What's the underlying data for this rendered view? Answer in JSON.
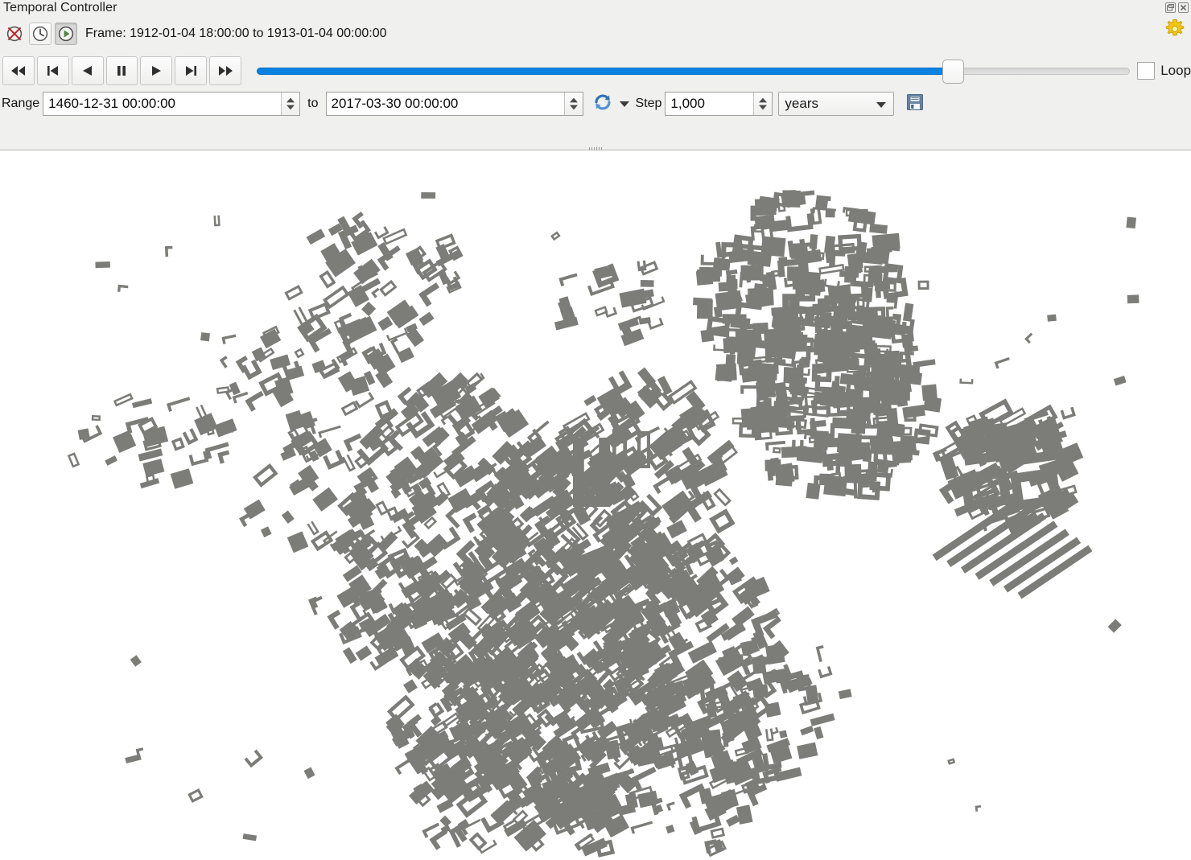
{
  "panel": {
    "title": "Temporal Controller",
    "dock_buttons": [
      {
        "name": "float-panel-icon",
        "label": "float"
      },
      {
        "name": "close-panel-icon",
        "label": "close"
      }
    ],
    "settings_icon": "gear-icon"
  },
  "modes": {
    "frame_label": "Frame: 1912-01-04 18:00:00 to 1913-01-04 00:00:00",
    "buttons": [
      {
        "name": "navigation-off-button",
        "icon": "circle-cross-icon",
        "label": "Turn off temporal navigation",
        "checked": false
      },
      {
        "name": "fixed-range-button",
        "icon": "clock-icon",
        "label": "Fixed range temporal navigation",
        "checked": false
      },
      {
        "name": "animated-range-button",
        "icon": "play-circle-icon",
        "label": "Animated temporal navigation",
        "checked": true
      }
    ]
  },
  "transport": {
    "buttons": [
      {
        "name": "rewind-to-start-button",
        "icon": "skip-start-icon",
        "label": "Rewind to start"
      },
      {
        "name": "step-backward-button",
        "icon": "step-back-icon",
        "label": "Back one frame"
      },
      {
        "name": "play-backward-button",
        "icon": "play-reverse-icon",
        "label": "Play backwards"
      },
      {
        "name": "pause-button",
        "icon": "pause-icon",
        "label": "Pause"
      },
      {
        "name": "play-forward-button",
        "icon": "play-icon",
        "label": "Play"
      },
      {
        "name": "step-forward-button",
        "icon": "step-forward-icon",
        "label": "Forward one frame"
      },
      {
        "name": "fast-forward-button",
        "icon": "skip-end-icon",
        "label": "Fast forward to end"
      }
    ],
    "slider": {
      "value_fraction": 0.795,
      "min": 0,
      "max": 1
    },
    "loop": {
      "label": "Loop",
      "checked": false
    }
  },
  "range": {
    "label": "Range",
    "start": "1460-12-31 00:00:00",
    "to_label": "to",
    "end": "2017-03-30 00:00:00",
    "refresh_icon": "refresh-icon",
    "step_label": "Step",
    "step_value": "1,000",
    "unit": "years",
    "save_icon": "save-icon"
  },
  "colors": {
    "accent_blue": "#0a82e2",
    "panel_bg": "#f0f0ef",
    "building_fill": "#7c7c78",
    "map_bg": "#ffffff",
    "gear_yellow": "#f2c80f"
  },
  "map": {
    "name": "map-canvas",
    "description": "Building footprints rendered as gray polygons on white background",
    "building_fill": "#7c7c78",
    "background": "#ffffff"
  }
}
